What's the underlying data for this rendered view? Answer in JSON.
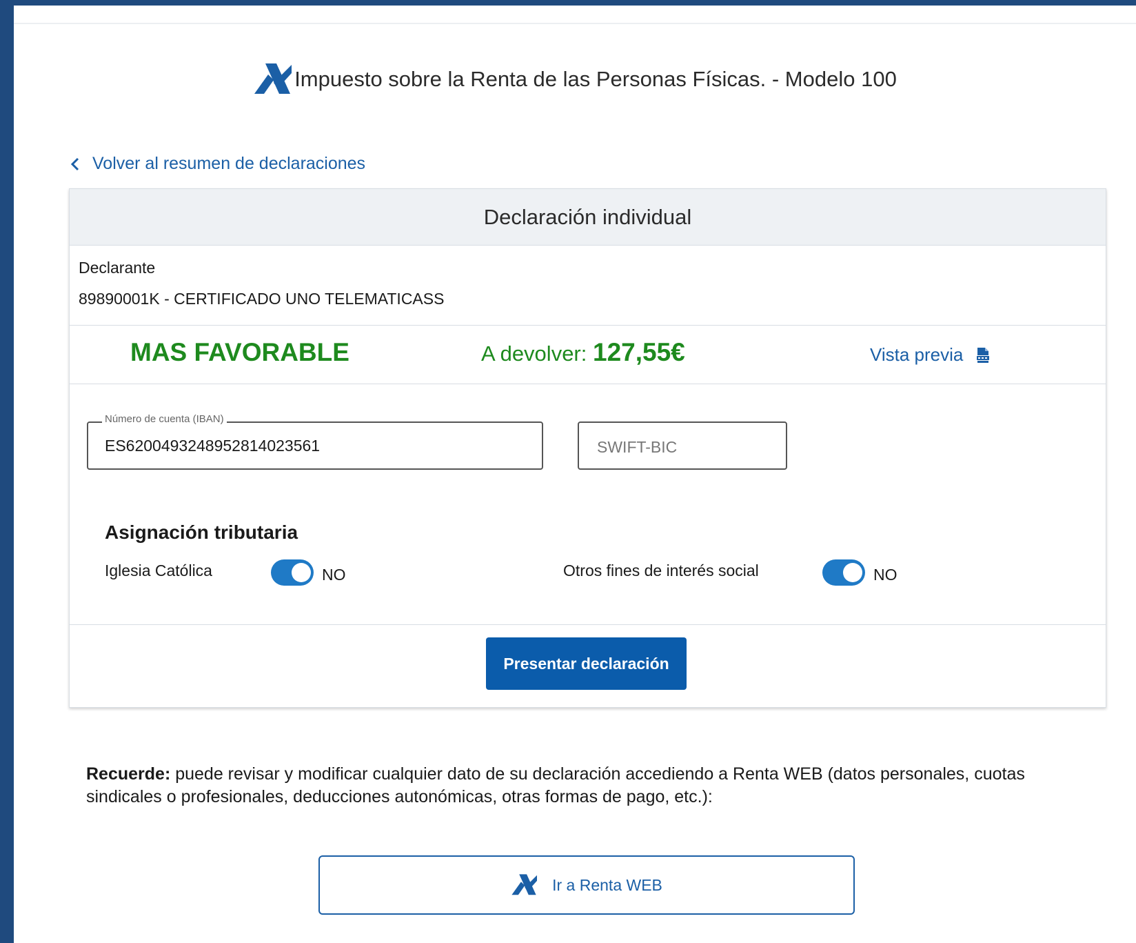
{
  "header": {
    "title": "Impuesto sobre la Renta de las Personas Físicas. - Modelo 100"
  },
  "nav": {
    "back_label": "Volver al resumen de declaraciones"
  },
  "card": {
    "title": "Declaración individual",
    "declarant_label": "Declarante",
    "declarant_value": "89890001K - CERTIFICADO UNO TELEMATICASS",
    "status": "MAS FAVORABLE",
    "refund_label": "A devolver:",
    "refund_amount": "127,55€",
    "preview_label": "Vista previa",
    "iban": {
      "legend": "Número de cuenta (IBAN)",
      "value": "ES6200493248952814023561"
    },
    "swift": {
      "placeholder": "SWIFT-BIC",
      "value": ""
    },
    "assignment": {
      "title": "Asignación tributaria",
      "church_label": "Iglesia Católica",
      "church_toggle": "NO",
      "social_label": "Otros fines de interés social",
      "social_toggle": "NO"
    },
    "submit_label": "Presentar declaración"
  },
  "reminder": {
    "bold": "Recuerde:",
    "text": " puede revisar y modificar cualquier dato de su declaración accediendo a Renta WEB (datos personales, cuotas sindicales o profesionales, deducciones autonómicas, otras formas de pago, etc.):"
  },
  "renta_web": {
    "label": "Ir a Renta WEB"
  },
  "colors": {
    "frame": "#1f4a7e",
    "link": "#1b5fa6",
    "success": "#1e8a1e",
    "primary": "#0b5cab",
    "toggle": "#1f7ac6"
  },
  "icons": {
    "logo": "aeat-logo-icon",
    "back": "chevron-left-icon",
    "preview": "pdf-icon"
  }
}
